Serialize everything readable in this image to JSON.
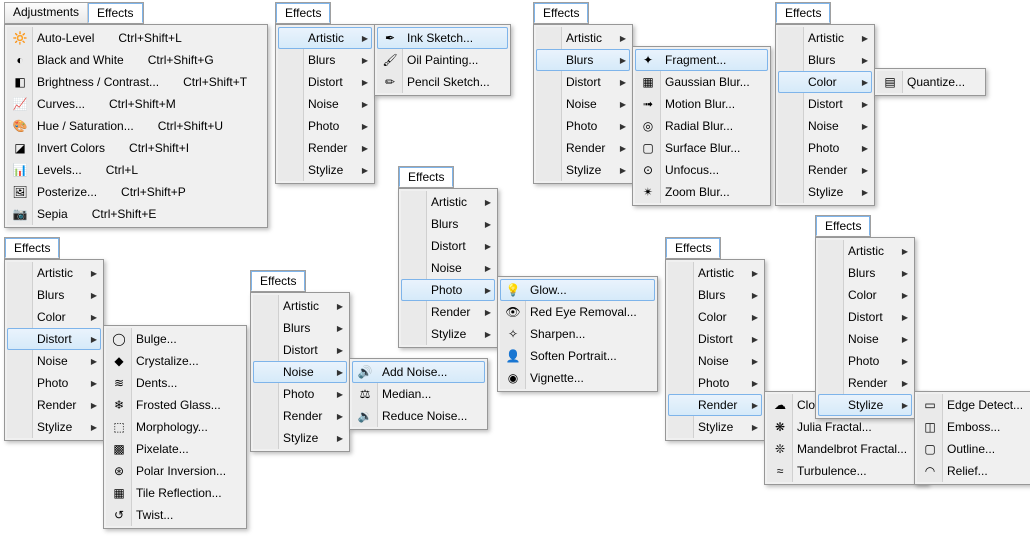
{
  "tabs": {
    "adjustments": "Adjustments",
    "effects": "Effects"
  },
  "adjustments_items": [
    {
      "label": "Auto-Level",
      "shortcut": "Ctrl+Shift+L"
    },
    {
      "label": "Black and White",
      "shortcut": "Ctrl+Shift+G"
    },
    {
      "label": "Brightness / Contrast...",
      "shortcut": "Ctrl+Shift+T"
    },
    {
      "label": "Curves...",
      "shortcut": "Ctrl+Shift+M"
    },
    {
      "label": "Hue / Saturation...",
      "shortcut": "Ctrl+Shift+U"
    },
    {
      "label": "Invert Colors",
      "shortcut": "Ctrl+Shift+I"
    },
    {
      "label": "Levels...",
      "shortcut": "Ctrl+L"
    },
    {
      "label": "Posterize...",
      "shortcut": "Ctrl+Shift+P"
    },
    {
      "label": "Sepia",
      "shortcut": "Ctrl+Shift+E"
    }
  ],
  "effects_items": [
    "Artistic",
    "Blurs",
    "Color",
    "Distort",
    "Noise",
    "Photo",
    "Render",
    "Stylize"
  ],
  "effects_items_nocolor": [
    "Artistic",
    "Blurs",
    "Distort",
    "Noise",
    "Photo",
    "Render",
    "Stylize"
  ],
  "sub": {
    "artistic": [
      "Ink Sketch...",
      "Oil Painting...",
      "Pencil Sketch..."
    ],
    "blurs": [
      "Fragment...",
      "Gaussian Blur...",
      "Motion Blur...",
      "Radial Blur...",
      "Surface Blur...",
      "Unfocus...",
      "Zoom Blur..."
    ],
    "color": [
      "Quantize..."
    ],
    "distort": [
      "Bulge...",
      "Crystalize...",
      "Dents...",
      "Frosted Glass...",
      "Morphology...",
      "Pixelate...",
      "Polar Inversion...",
      "Tile Reflection...",
      "Twist..."
    ],
    "noise": [
      "Add Noise...",
      "Median...",
      "Reduce Noise..."
    ],
    "photo": [
      "Glow...",
      "Red Eye Removal...",
      "Sharpen...",
      "Soften Portrait...",
      "Vignette..."
    ],
    "render": [
      "Clouds...",
      "Julia Fractal...",
      "Mandelbrot Fractal...",
      "Turbulence..."
    ],
    "stylize": [
      "Edge Detect...",
      "Emboss...",
      "Outline...",
      "Relief..."
    ]
  }
}
